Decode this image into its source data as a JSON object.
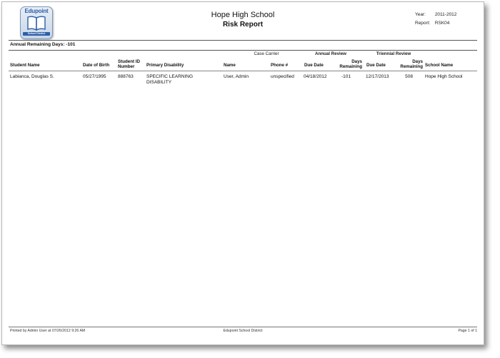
{
  "logo": {
    "word": "Edupoint",
    "district": "School District"
  },
  "header": {
    "school": "Hope High School",
    "report_title": "Risk Report",
    "year_label": "Year:",
    "year_value": "2011-2012",
    "report_label": "Report:",
    "report_value": "RSK04"
  },
  "annual_remaining": "Annual Remaining Days: -101",
  "groups": {
    "case_carrier": "Case Carrier",
    "annual_review": "Annual Review",
    "triennial_review": "Triennial Review"
  },
  "columns": {
    "student_name": "Student Name",
    "dob": "Date of Birth",
    "student_id_1": "Student ID",
    "student_id_2": "Number",
    "primary_disability": "Primary Disability",
    "name": "Name",
    "phone": "Phone #",
    "annual_due": "Due Date",
    "annual_days_1": "Days",
    "annual_days_2": "Remaining",
    "tri_due": "Due Date",
    "tri_days_1": "Days",
    "tri_days_2": "Remaining",
    "school_name": "School Name"
  },
  "rows": [
    {
      "student_name": "Labianca, Douglas S.",
      "dob": "05/27/1995",
      "student_id": "888763",
      "disability_1": "SPECIFIC LEARNING",
      "disability_2": "DISABILITY",
      "carrier_name": "User, Admin",
      "phone": "unspecified",
      "annual_due": "04/18/2012",
      "annual_days": "-101",
      "tri_due": "12/17/2013",
      "tri_days": "508",
      "school_name": "Hope High School"
    }
  ],
  "footer": {
    "printed": "Printed by Admin User at 07/26/2012 9:26 AM",
    "district": "Edupoint School District",
    "page": "Page 1 of 1"
  }
}
